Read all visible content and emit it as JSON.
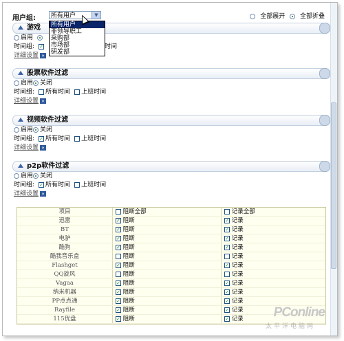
{
  "topbar": {
    "group_label": "用户组:",
    "group_value": "所有用户",
    "expand_all": "全部展开",
    "collapse_all": "全部折叠"
  },
  "dropdown": {
    "options": [
      "所有用户",
      "非领导职工",
      "采购部",
      "市场部",
      "研发部"
    ]
  },
  "sections": [
    {
      "title": "游戏软件过滤",
      "title_visible": "游戏",
      "enable": "启用",
      "disable": "关闭",
      "time_label": "时间组:",
      "time_all": "所有时间",
      "time_work": "上班时间",
      "detail": "详细设置"
    },
    {
      "title": "股票软件过滤",
      "enable": "启用",
      "disable": "关闭",
      "time_label": "时间组:",
      "time_all": "所有时间",
      "time_work": "上班时间",
      "detail": "详细设置"
    },
    {
      "title": "视频软件过滤",
      "enable": "启用",
      "disable": "关闭",
      "time_label": "时间组:",
      "time_all": "所有时间",
      "time_work": "上班时间",
      "detail": "详细设置"
    },
    {
      "title": "p2p软件过滤",
      "enable": "启用",
      "disable": "关闭",
      "time_label": "时间组:",
      "time_all": "所有时间",
      "time_work": "上班时间",
      "detail": "详细设置"
    }
  ],
  "p2p_table": {
    "headers": {
      "item": "项目",
      "block_all": "阻断全部",
      "log_all": "记录全部"
    },
    "block_label": "阻断",
    "log_label": "记录",
    "rows": [
      {
        "name": "迅雷",
        "block": true,
        "log": true
      },
      {
        "name": "BT",
        "block": true,
        "log": true
      },
      {
        "name": "电驴",
        "block": true,
        "log": true
      },
      {
        "name": "酷狗",
        "block": true,
        "log": true
      },
      {
        "name": "酷我音乐盒",
        "block": false,
        "log": false
      },
      {
        "name": "Flashget",
        "block": true,
        "log": true
      },
      {
        "name": "QQ旋风",
        "block": false,
        "log": false
      },
      {
        "name": "Vagaa",
        "block": true,
        "log": true
      },
      {
        "name": "纳米机器",
        "block": true,
        "log": true
      },
      {
        "name": "PP点点通",
        "block": true,
        "log": true
      },
      {
        "name": "Rayfile",
        "block": true,
        "log": true
      },
      {
        "name": "115优盘",
        "block": true,
        "log": true
      }
    ]
  },
  "watermark": {
    "logo": "PConline",
    "sub": "太平洋电脑网"
  }
}
